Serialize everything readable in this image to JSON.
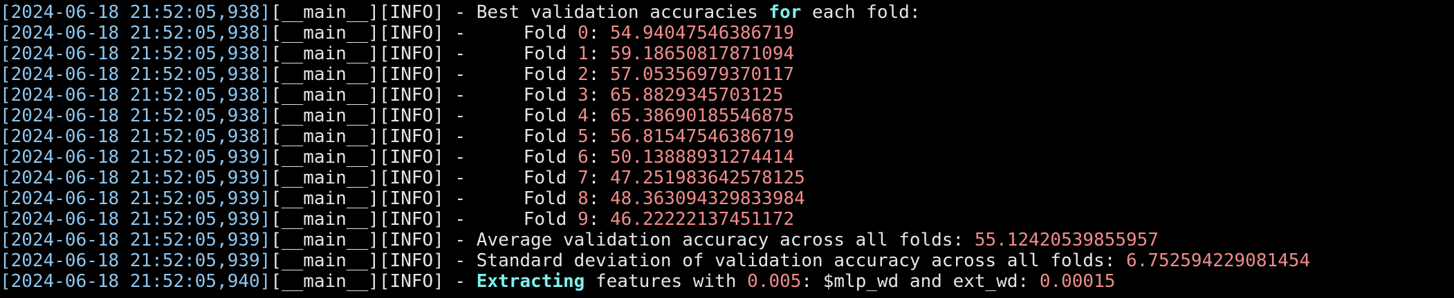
{
  "terminal": {
    "colors": {
      "background": "#000000",
      "text": "#e6e6e6",
      "timestamp": "#8ec7f0",
      "keyword": "#7ef0ee",
      "number": "#f08c8c"
    },
    "lines": [
      {
        "timestamp": "[2024-06-18 21:52:05,938]",
        "module": "[__main__]",
        "level": "[INFO]",
        "sep": " - ",
        "msg": {
          "a": "Best validation accuracies ",
          "kw": "for",
          "b": " each fold",
          "colon": ":"
        }
      },
      {
        "timestamp": "[2024-06-18 21:52:05,938]",
        "module": "[__main__]",
        "level": "[INFO]",
        "sep": " - ",
        "fold": {
          "label": "Fold ",
          "idx": "0",
          "colon": ": ",
          "value": "54.94047546386719"
        }
      },
      {
        "timestamp": "[2024-06-18 21:52:05,938]",
        "module": "[__main__]",
        "level": "[INFO]",
        "sep": " - ",
        "fold": {
          "label": "Fold ",
          "idx": "1",
          "colon": ": ",
          "value": "59.18650817871094"
        }
      },
      {
        "timestamp": "[2024-06-18 21:52:05,938]",
        "module": "[__main__]",
        "level": "[INFO]",
        "sep": " - ",
        "fold": {
          "label": "Fold ",
          "idx": "2",
          "colon": ": ",
          "value": "57.05356979370117"
        }
      },
      {
        "timestamp": "[2024-06-18 21:52:05,938]",
        "module": "[__main__]",
        "level": "[INFO]",
        "sep": " - ",
        "fold": {
          "label": "Fold ",
          "idx": "3",
          "colon": ": ",
          "value": "65.8829345703125"
        }
      },
      {
        "timestamp": "[2024-06-18 21:52:05,938]",
        "module": "[__main__]",
        "level": "[INFO]",
        "sep": " - ",
        "fold": {
          "label": "Fold ",
          "idx": "4",
          "colon": ": ",
          "value": "65.38690185546875"
        }
      },
      {
        "timestamp": "[2024-06-18 21:52:05,938]",
        "module": "[__main__]",
        "level": "[INFO]",
        "sep": " - ",
        "fold": {
          "label": "Fold ",
          "idx": "5",
          "colon": ": ",
          "value": "56.81547546386719"
        }
      },
      {
        "timestamp": "[2024-06-18 21:52:05,939]",
        "module": "[__main__]",
        "level": "[INFO]",
        "sep": " - ",
        "fold": {
          "label": "Fold ",
          "idx": "6",
          "colon": ": ",
          "value": "50.13888931274414"
        }
      },
      {
        "timestamp": "[2024-06-18 21:52:05,939]",
        "module": "[__main__]",
        "level": "[INFO]",
        "sep": " - ",
        "fold": {
          "label": "Fold ",
          "idx": "7",
          "colon": ": ",
          "value": "47.251983642578125"
        }
      },
      {
        "timestamp": "[2024-06-18 21:52:05,939]",
        "module": "[__main__]",
        "level": "[INFO]",
        "sep": " - ",
        "fold": {
          "label": "Fold ",
          "idx": "8",
          "colon": ": ",
          "value": "48.363094329833984"
        }
      },
      {
        "timestamp": "[2024-06-18 21:52:05,939]",
        "module": "[__main__]",
        "level": "[INFO]",
        "sep": " - ",
        "fold": {
          "label": "Fold ",
          "idx": "9",
          "colon": ": ",
          "value": "46.22222137451172"
        }
      },
      {
        "timestamp": "[2024-06-18 21:52:05,939]",
        "module": "[__main__]",
        "level": "[INFO]",
        "sep": " - ",
        "stat": {
          "text": "Average validation accuracy across all folds",
          "colon": ": ",
          "value": "55.12420539855957"
        }
      },
      {
        "timestamp": "[2024-06-18 21:52:05,939]",
        "module": "[__main__]",
        "level": "[INFO]",
        "sep": " - ",
        "stat": {
          "text": "Standard deviation of validation accuracy across all folds",
          "colon": ": ",
          "value": "6.752594229081454"
        }
      },
      {
        "timestamp": "[2024-06-18 21:52:05,940]",
        "module": "[__main__]",
        "level": "[INFO]",
        "sep": " - ",
        "extract": {
          "kw": "Extracting",
          "a": " features with ",
          "val1": "0.005",
          "colon1": ": ",
          "b": "$mlp_wd and ext_wd",
          "colon2": ": ",
          "val2": "0.00015"
        }
      }
    ]
  }
}
